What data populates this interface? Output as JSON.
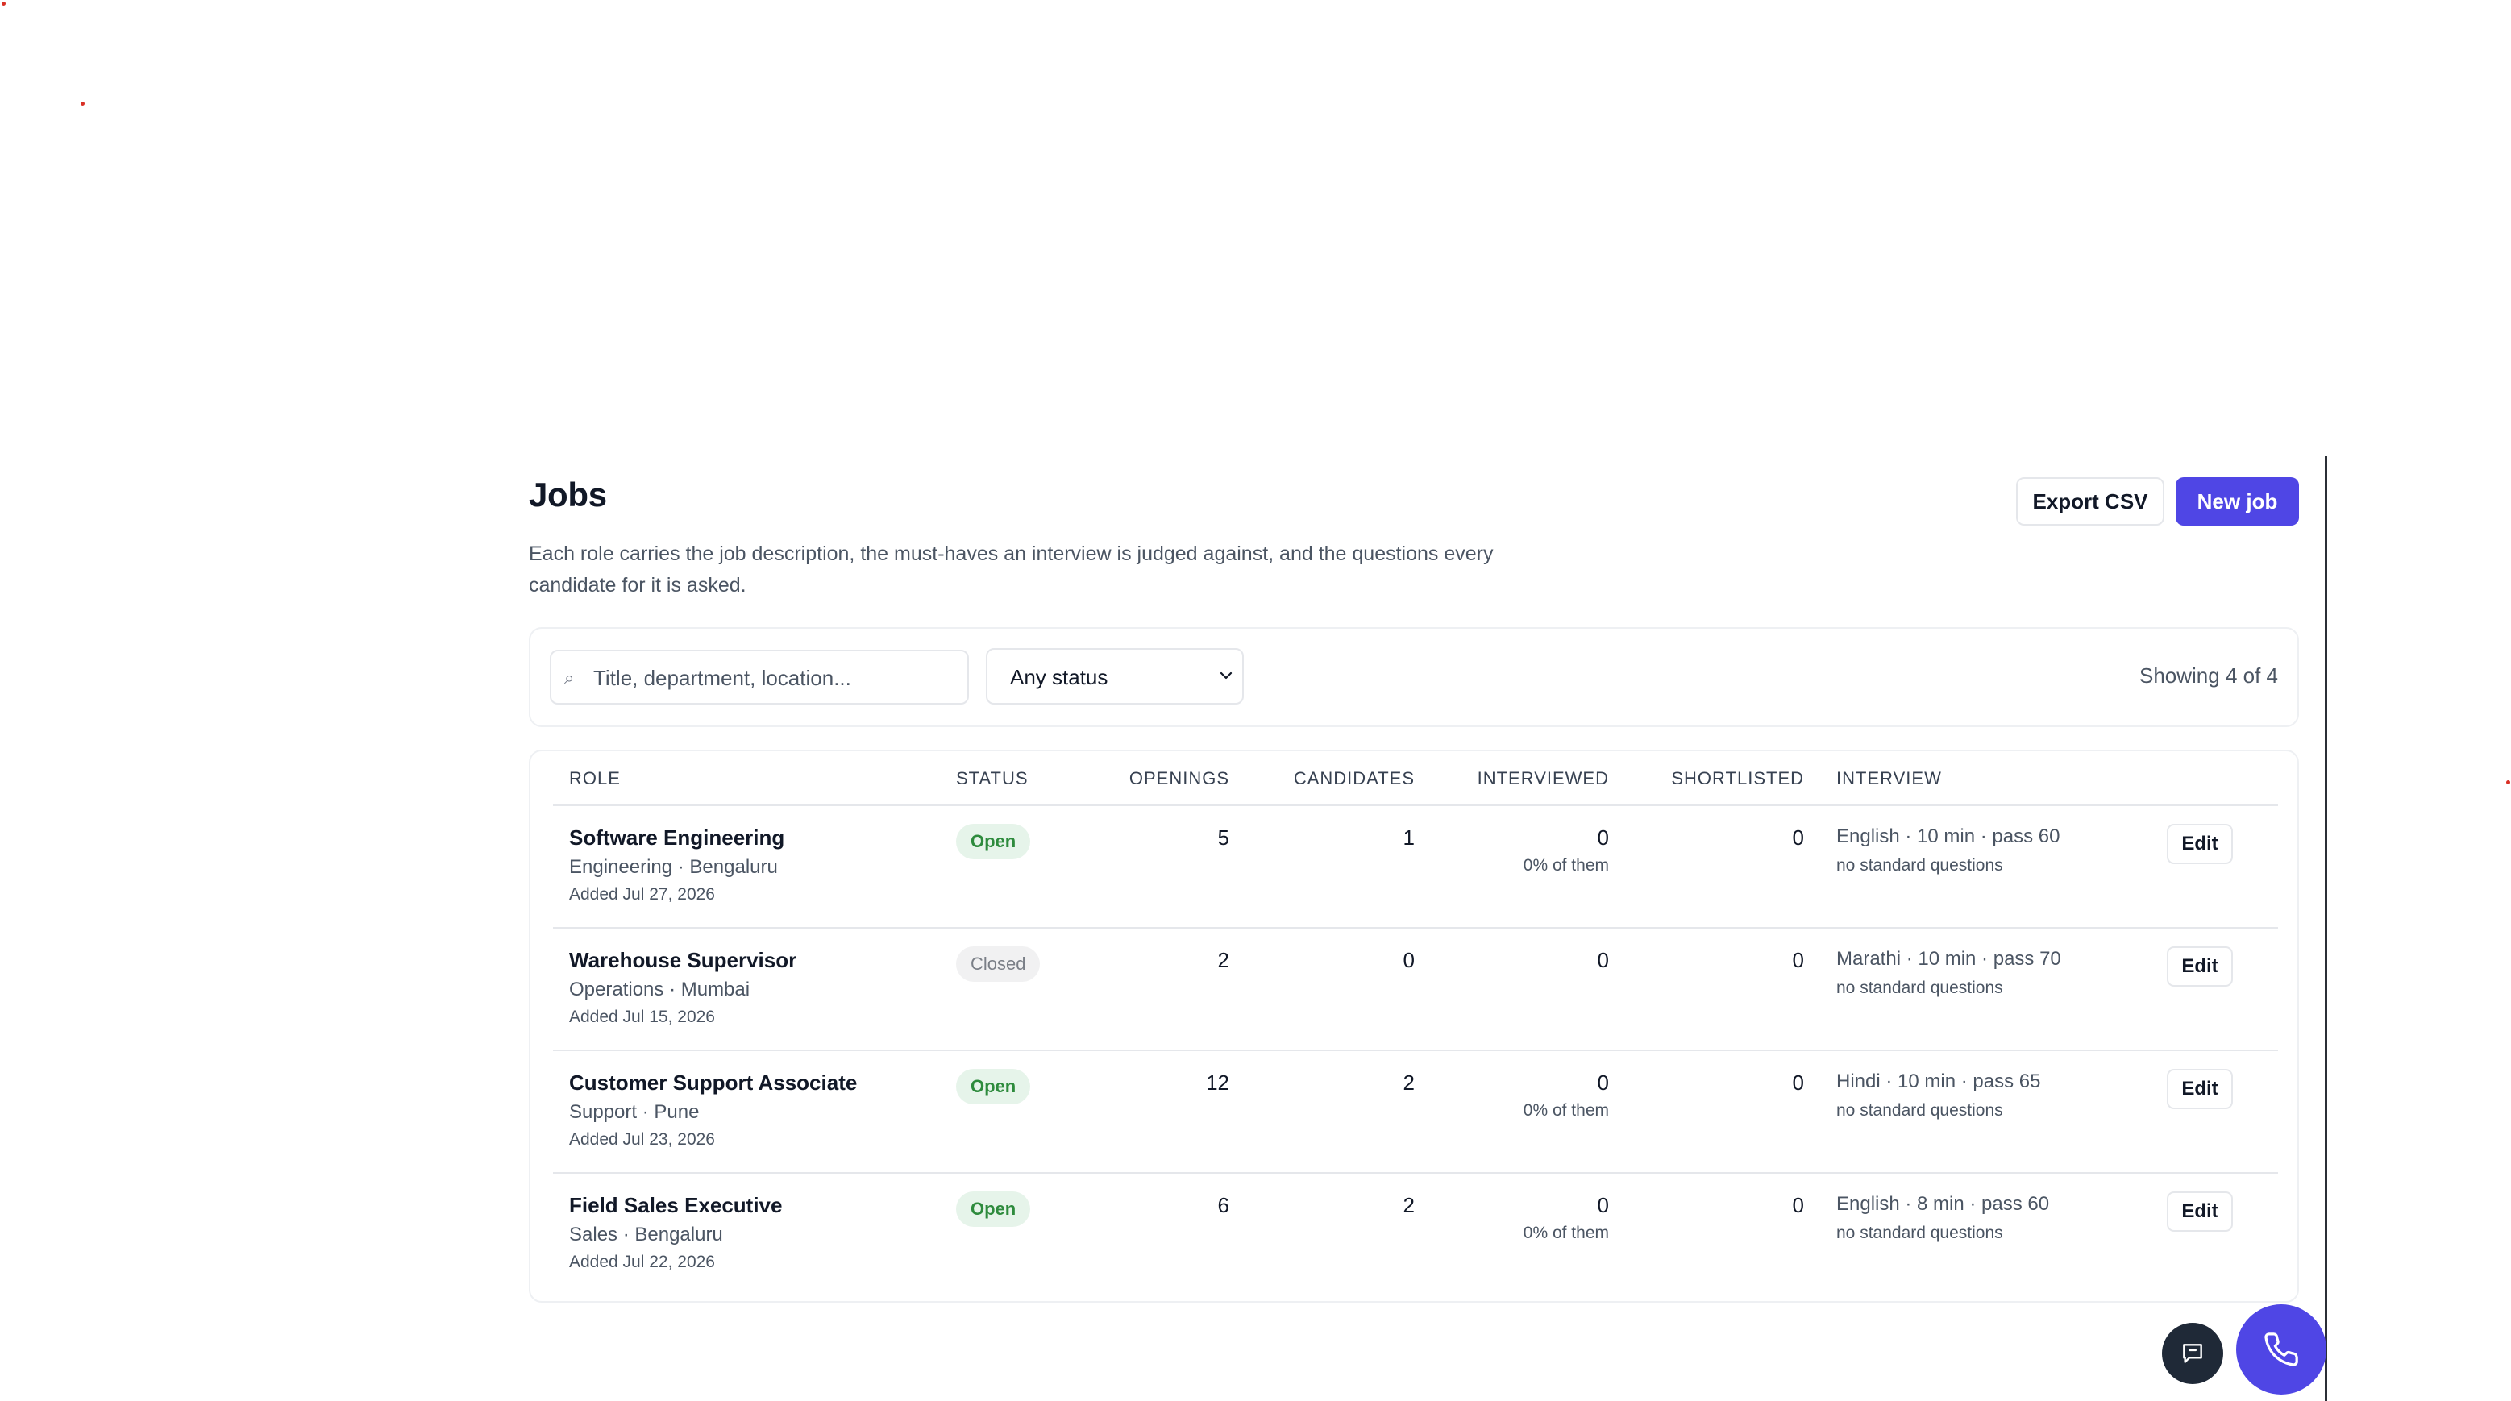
{
  "header": {
    "title": "Jobs",
    "subtitle": "Each role carries the job description, the must-haves an interview is judged against, and the questions every candidate for it is asked.",
    "export_label": "Export CSV",
    "new_job_label": "New job"
  },
  "filters": {
    "search_placeholder": "Title, department, location...",
    "search_icon": "search-icon",
    "status_value": "Any status",
    "showing": "Showing 4 of 4"
  },
  "table": {
    "columns": {
      "role": "ROLE",
      "status": "STATUS",
      "openings": "OPENINGS",
      "candidates": "CANDIDATES",
      "interviewed": "INTERVIEWED",
      "shortlisted": "SHORTLISTED",
      "interview": "INTERVIEW"
    },
    "rows": [
      {
        "title": "Software Engineering",
        "meta": "Engineering · Bengaluru",
        "added": "Added Jul 27, 2026",
        "status": "Open",
        "openings": "5",
        "candidates": "1",
        "interviewed": "0",
        "interviewed_pct": "0% of them",
        "shortlisted": "0",
        "interview": "English · 10 min · pass 60",
        "questions": "no standard questions",
        "edit_label": "Edit"
      },
      {
        "title": "Warehouse Supervisor",
        "meta": "Operations · Mumbai",
        "added": "Added Jul 15, 2026",
        "status": "Closed",
        "openings": "2",
        "candidates": "0",
        "interviewed": "0",
        "interviewed_pct": "",
        "shortlisted": "0",
        "interview": "Marathi · 10 min · pass 70",
        "questions": "no standard questions",
        "edit_label": "Edit"
      },
      {
        "title": "Customer Support Associate",
        "meta": "Support · Pune",
        "added": "Added Jul 23, 2026",
        "status": "Open",
        "openings": "12",
        "candidates": "2",
        "interviewed": "0",
        "interviewed_pct": "0% of them",
        "shortlisted": "0",
        "interview": "Hindi · 10 min · pass 65",
        "questions": "no standard questions",
        "edit_label": "Edit"
      },
      {
        "title": "Field Sales Executive",
        "meta": "Sales · Bengaluru",
        "added": "Added Jul 22, 2026",
        "status": "Open",
        "openings": "6",
        "candidates": "2",
        "interviewed": "0",
        "interviewed_pct": "0% of them",
        "shortlisted": "0",
        "interview": "English · 8 min · pass 60",
        "questions": "no standard questions",
        "edit_label": "Edit"
      }
    ]
  },
  "fabs": {
    "chat_icon": "chat-icon",
    "call_icon": "phone-icon"
  },
  "colors": {
    "accent": "#4f46e5",
    "open_badge_bg": "#e6f4ea",
    "open_badge_text": "#2e8b3d",
    "closed_badge_bg": "#f1f1f2",
    "dark_fab": "#1f2937"
  }
}
